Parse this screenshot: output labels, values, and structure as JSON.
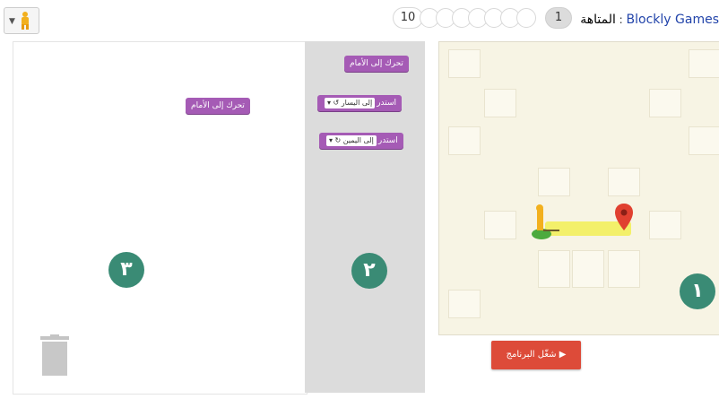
{
  "header": {
    "app_link": "Blockly Games",
    "separator": " : ",
    "game_title": "المتاهة",
    "current_level": "1",
    "max_level": "10"
  },
  "toolbox": {
    "blocks": [
      {
        "label": "تحرك إلى الأمام"
      },
      {
        "label": "استدر",
        "dropdown": "إلى اليسار ↺ ▾"
      },
      {
        "label": "استدر",
        "dropdown": "إلى اليمين ↻ ▾"
      }
    ]
  },
  "workspace": {
    "blocks": [
      {
        "label": "تحرك إلى الأمام"
      }
    ]
  },
  "badges": {
    "game": "١",
    "toolbox": "٢",
    "workspace": "٣"
  },
  "run_button": {
    "label": "شغّل البرنامج"
  },
  "colors": {
    "block": "#a55bb5",
    "badge": "#3a8b75",
    "run": "#dd4b39",
    "path": "#f3f06a"
  },
  "icons": {
    "pegman_selector": "pegman-icon",
    "trash": "trash-icon",
    "goal": "map-marker-icon",
    "player": "pegman-icon",
    "run": "play-icon"
  }
}
